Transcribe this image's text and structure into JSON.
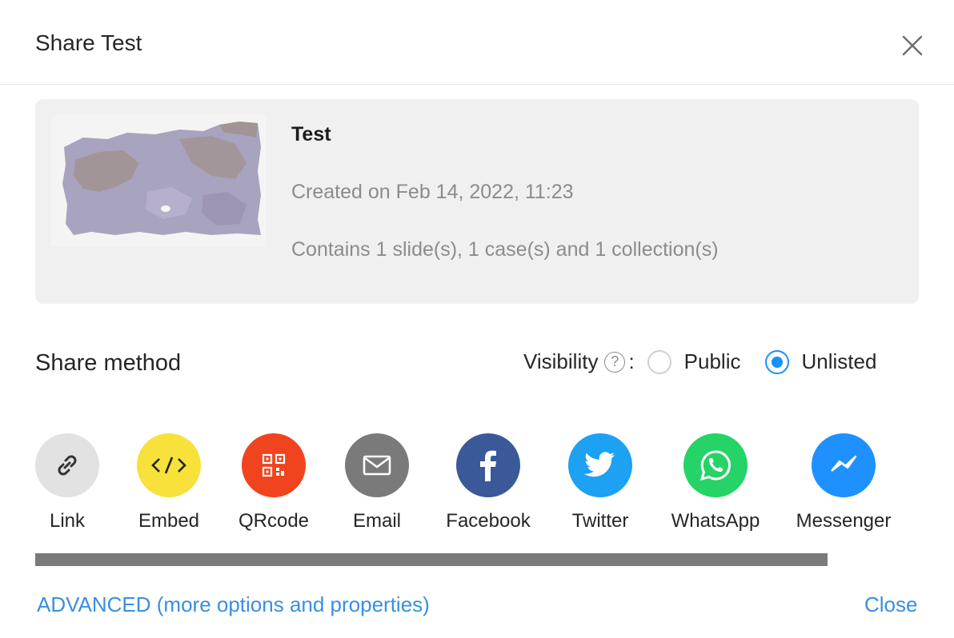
{
  "dialog": {
    "title": "Share Test",
    "close_icon": "close-icon"
  },
  "item": {
    "title": "Test",
    "created": "Created on Feb 14, 2022, 11:23",
    "contains": "Contains 1 slide(s), 1 case(s) and 1 collection(s)"
  },
  "share": {
    "heading": "Share method",
    "visibility_label": "Visibility",
    "visibility_colon": ":",
    "visibility_options": [
      {
        "label": "Public",
        "selected": false
      },
      {
        "label": "Unlisted",
        "selected": true
      }
    ],
    "methods": [
      {
        "label": "Link",
        "icon": "link-icon",
        "color": "#e2e2e2"
      },
      {
        "label": "Embed",
        "icon": "embed-code-icon",
        "color": "#f7e13a"
      },
      {
        "label": "QRcode",
        "icon": "qrcode-icon",
        "color": "#f0441e"
      },
      {
        "label": "Email",
        "icon": "email-icon",
        "color": "#7a7a7a"
      },
      {
        "label": "Facebook",
        "icon": "facebook-icon",
        "color": "#3b5998"
      },
      {
        "label": "Twitter",
        "icon": "twitter-icon",
        "color": "#1da1f2"
      },
      {
        "label": "WhatsApp",
        "icon": "whatsapp-icon",
        "color": "#25d366"
      },
      {
        "label": "Messenger",
        "icon": "messenger-icon",
        "color": "#1e90ff"
      }
    ]
  },
  "footer": {
    "advanced_label": "ADVANCED (more options and properties)",
    "close_label": "Close"
  },
  "colors": {
    "accent": "#1890ff",
    "link": "#3a8fe0"
  }
}
